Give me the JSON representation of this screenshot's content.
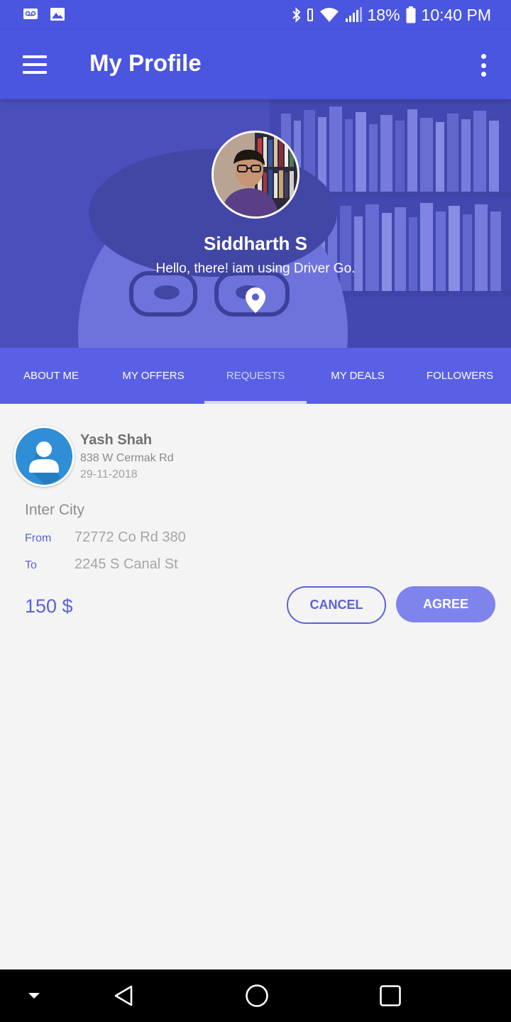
{
  "status_bar": {
    "battery": "18%",
    "time": "10:40 PM",
    "icons": [
      "voicemail-icon",
      "image-icon",
      "bluetooth-icon",
      "vibrate-icon",
      "wifi-icon",
      "signal-icon",
      "battery-icon"
    ]
  },
  "app_bar": {
    "title": "My Profile",
    "icons": [
      "menu-icon",
      "more-vert-icon"
    ]
  },
  "profile": {
    "name": "Siddharth S",
    "status": "Hello, there! iam using Driver Go.",
    "icons": [
      "location-pin-icon"
    ]
  },
  "tabs": [
    {
      "label": "ABOUT ME",
      "active": false
    },
    {
      "label": "MY OFFERS",
      "active": false
    },
    {
      "label": "REQUESTS",
      "active": true
    },
    {
      "label": "MY DEALS",
      "active": false
    },
    {
      "label": "FOLLOWERS",
      "active": false
    }
  ],
  "request": {
    "name": "Yash Shah",
    "address": "838 W Cermak Rd",
    "date": "29-11-2018",
    "trip_type": "Inter City",
    "from_label": "From",
    "from_value": "72772 Co Rd 380",
    "to_label": "To",
    "to_value": "2245 S Canal St",
    "price": "150 $",
    "cancel_label": "CANCEL",
    "agree_label": "AGREE"
  },
  "nav_bar": {
    "icons": [
      "dropdown-icon",
      "back-icon",
      "home-icon",
      "recents-icon"
    ]
  },
  "colors": {
    "primary": "#4a55e0",
    "tab_bar": "#5960e6",
    "accent_text": "#5b62d8",
    "agree_button": "#7f84ec",
    "background": "#f4f4f4",
    "nav_bar": "#000000"
  }
}
